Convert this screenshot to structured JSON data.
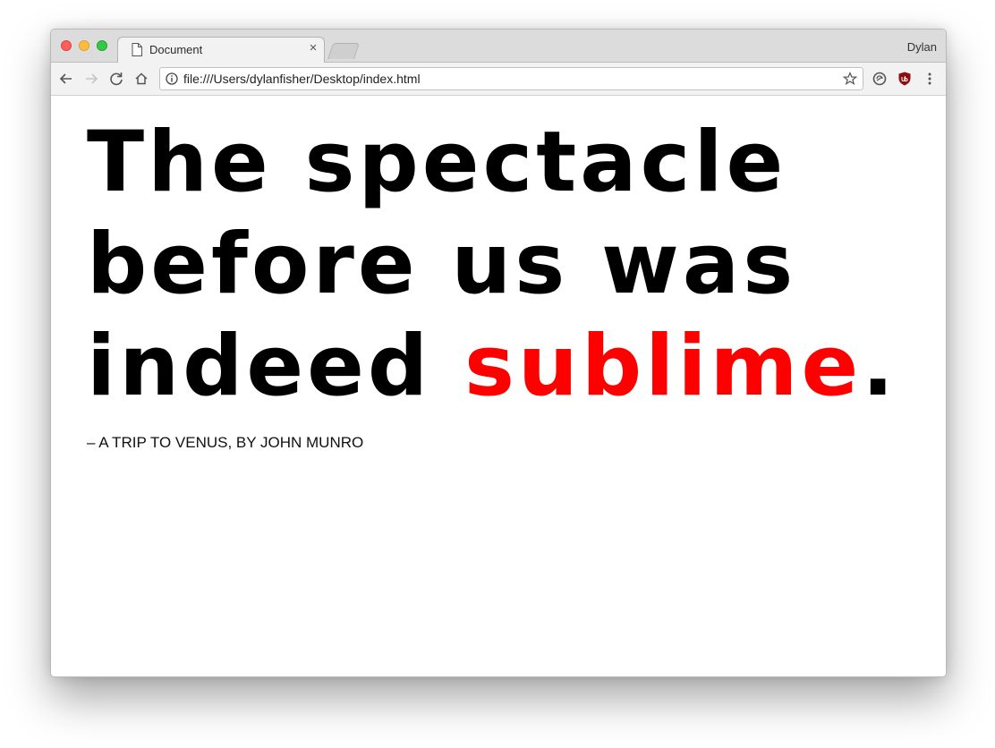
{
  "browser": {
    "tab_title": "Document",
    "tab_close": "×",
    "profile_name": "Dylan",
    "url": "file:///Users/dylanfisher/Desktop/index.html"
  },
  "page": {
    "headline_part1": "The spectacle before us was indeed ",
    "headline_accent": "sublime",
    "headline_end": ".",
    "attribution": "– A TRIP TO VENUS, BY JOHN MUNRO",
    "accent_color": "#ff0000"
  },
  "icons": {
    "back": "back-arrow-icon",
    "forward": "forward-arrow-icon",
    "reload": "reload-icon",
    "home": "home-icon",
    "info": "info-icon",
    "bookmark": "star-icon",
    "sync": "sync-icon",
    "ublock": "ublock-shield-icon",
    "menu": "menu-kebab-icon"
  }
}
